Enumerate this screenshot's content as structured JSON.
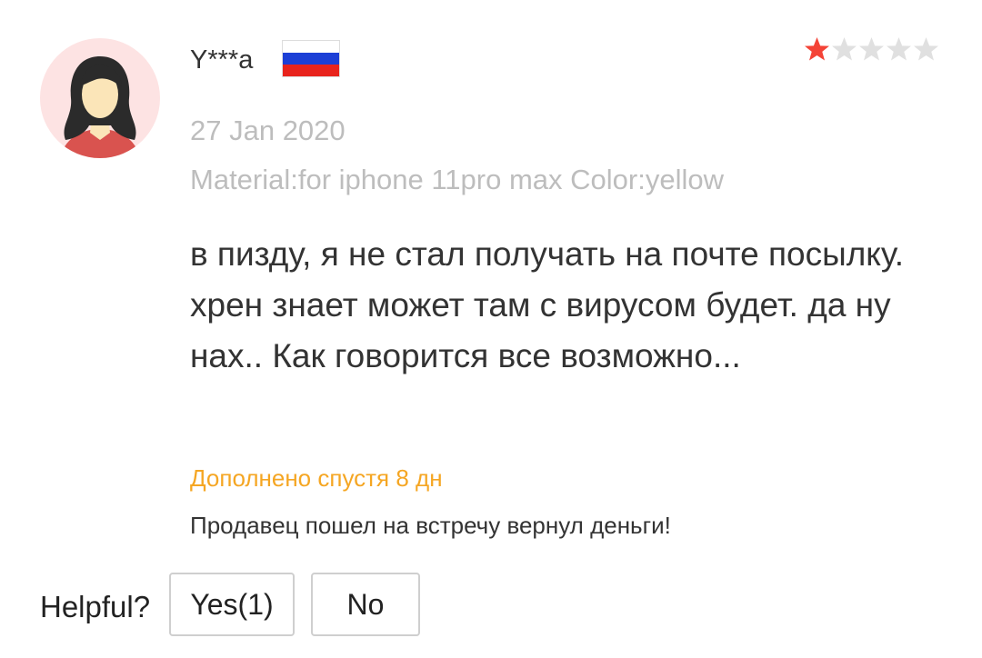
{
  "review": {
    "author": "Y***a",
    "country_flag": "russia-flag",
    "rating": 1,
    "rating_max": 5,
    "date": "27 Jan 2020",
    "meta": "Material:for iphone 11pro max Color:yellow",
    "text": "в пизду, я не стал получать на почте посылку. хрен знает может там с вирусом будет. да ну нах..  Как говорится все возможно...",
    "followup_label": "Дополнено спустя 8 дн",
    "followup_text": "Продавец пошел на встречу вернул деньги!"
  },
  "helpful": {
    "label": "Helpful?",
    "yes_label": "Yes(1)",
    "no_label": "No"
  },
  "colors": {
    "star_active": "#f44336",
    "star_inactive": "#e0e0e0",
    "followup_accent": "#f5a623",
    "muted_text": "#bdbdbd",
    "avatar_bg": "#fde3e3"
  }
}
